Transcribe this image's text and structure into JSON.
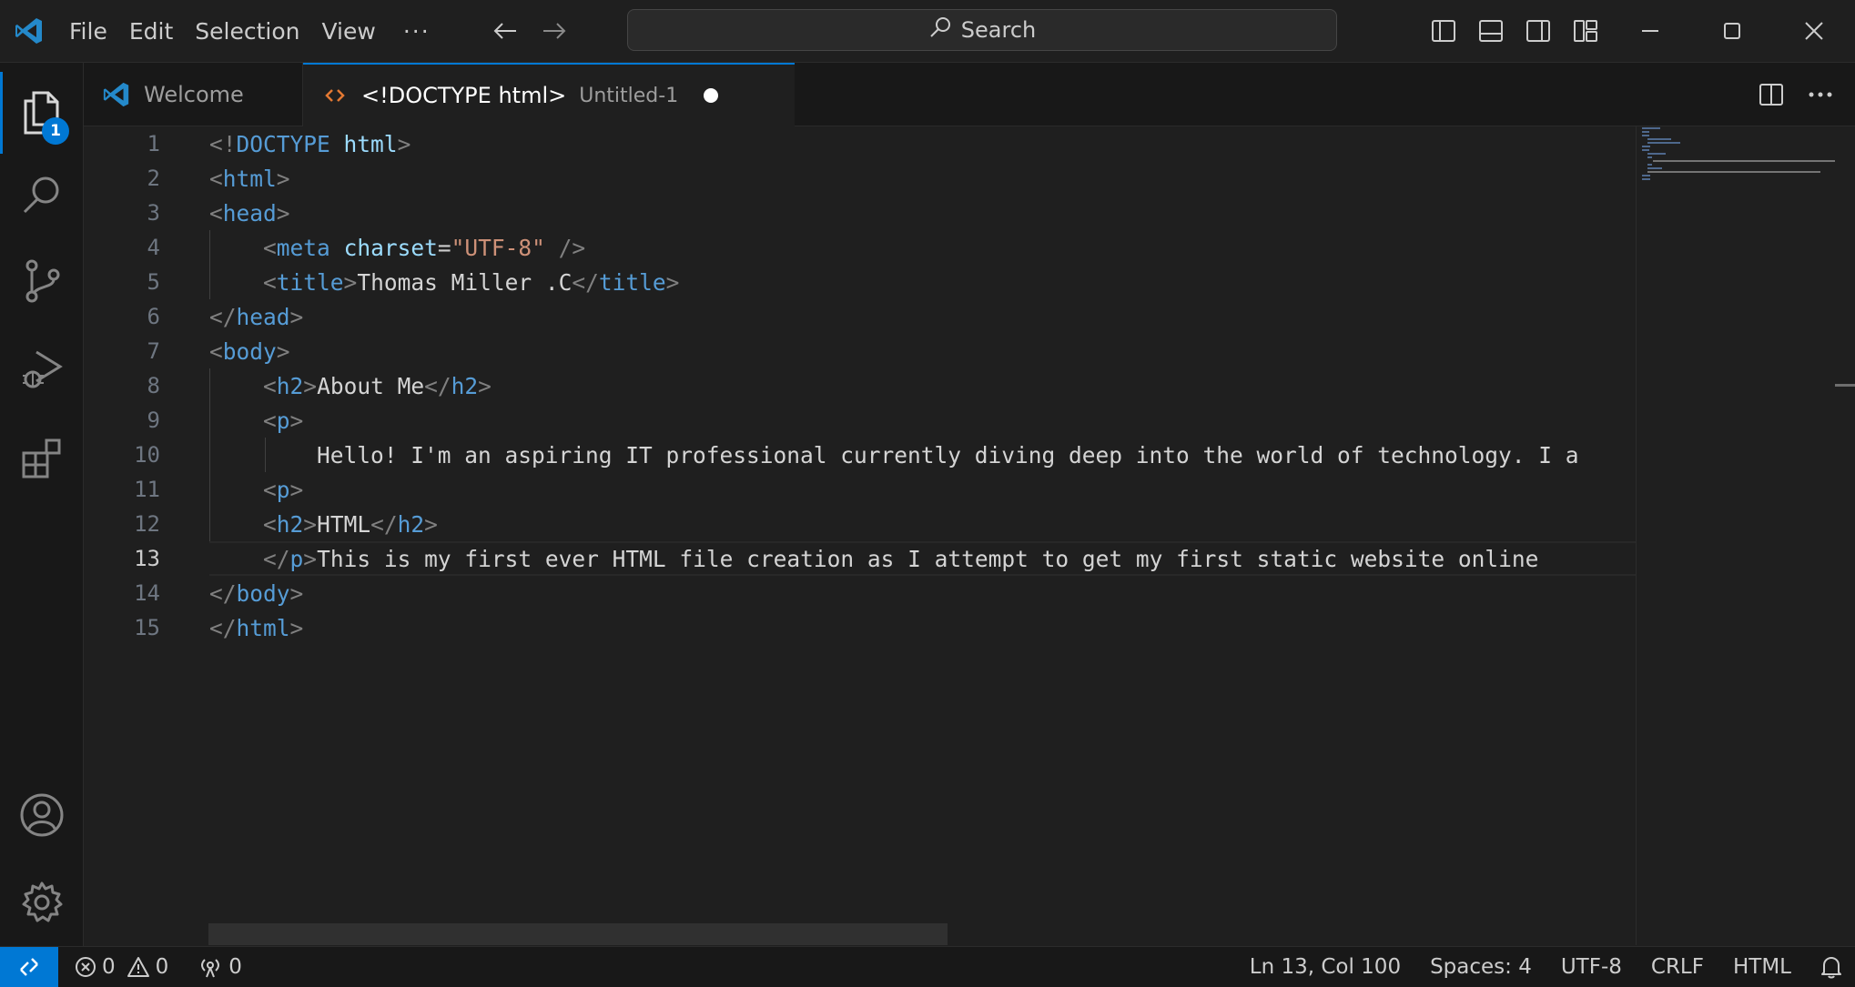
{
  "menu": {
    "file": "File",
    "edit": "Edit",
    "selection": "Selection",
    "view": "View",
    "more": "···"
  },
  "search": {
    "label": "Search"
  },
  "activity": {
    "explorer_badge": "1"
  },
  "tabs": {
    "welcome": "Welcome",
    "untitled_title": "<!DOCTYPE html>",
    "untitled_desc": "Untitled-1"
  },
  "editor": {
    "line_numbers": [
      "1",
      "2",
      "3",
      "4",
      "5",
      "6",
      "7",
      "8",
      "9",
      "10",
      "11",
      "12",
      "13",
      "14",
      "15"
    ],
    "current_line": "13",
    "lines": [
      "<!DOCTYPE html>",
      "<html>",
      "<head>",
      "    <meta charset=\"UTF-8\" />",
      "    <title>Thomas Miller .C</title>",
      "</head>",
      "<body>",
      "    <h2>About Me</h2>",
      "    <p>",
      "        Hello! I'm an aspiring IT professional currently diving deep into the world of technology. I a",
      "    <p>",
      "    <h2>HTML</h2>",
      "    </p>This is my first ever HTML file creation as I attempt to get my first static website online",
      "</body>",
      "</html>"
    ]
  },
  "status": {
    "errors": "0",
    "warnings": "0",
    "ports": "0",
    "position": "Ln 13, Col 100",
    "spaces": "Spaces: 4",
    "encoding": "UTF-8",
    "eol": "CRLF",
    "language": "HTML"
  },
  "colors": {
    "accent": "#0078d4",
    "tag": "#569cd6",
    "attr": "#9cdcfe",
    "string": "#ce9178"
  }
}
